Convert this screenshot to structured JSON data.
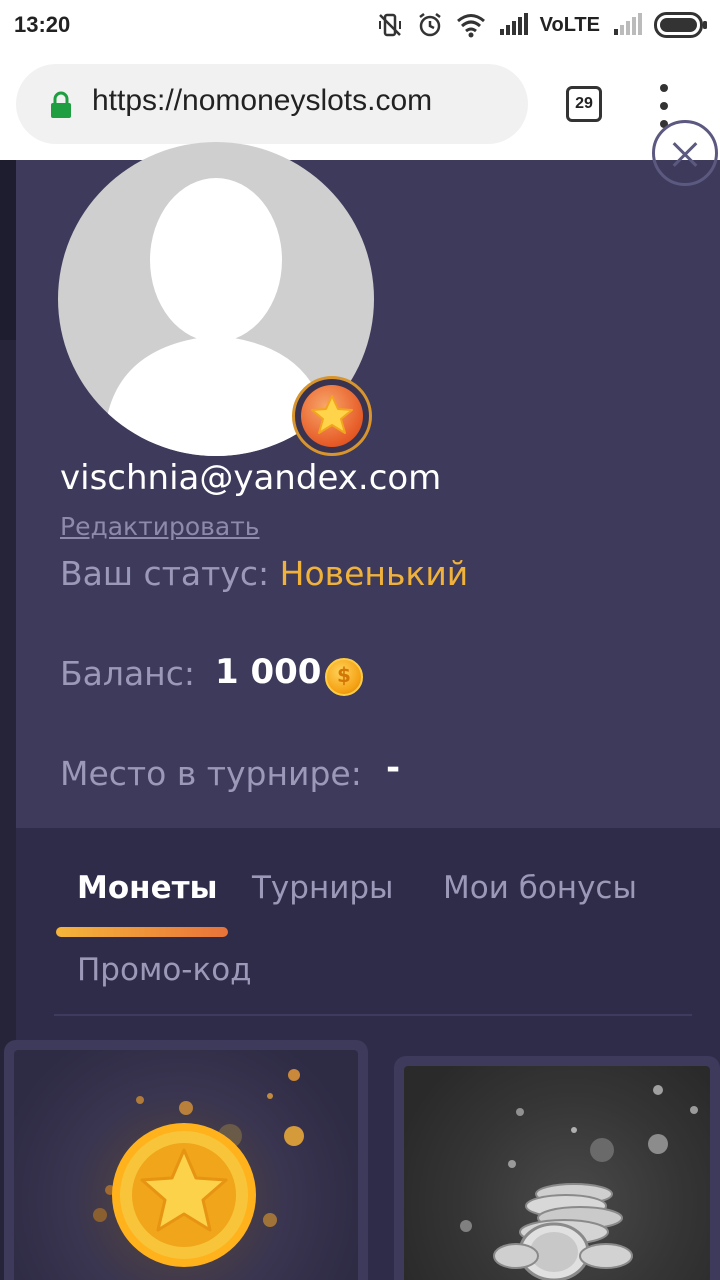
{
  "status_bar": {
    "time": "13:20",
    "network": "VoLTE",
    "icons": [
      "vibrate-off-icon",
      "alarm-icon",
      "wifi-icon",
      "signal-icon",
      "battery-icon"
    ]
  },
  "browser": {
    "url": "https://nomoneyslots.com",
    "tab_count": "29",
    "lock_color": "#1e9e40"
  },
  "profile": {
    "email": "vischnia@yandex.com",
    "edit_label": "Редактировать",
    "status_label": "Ваш статус: ",
    "status_value": "Новенький",
    "balance_label": "Баланс:",
    "balance_value": "1 000",
    "tournament_label": "Место в турнире:",
    "tournament_value": "-"
  },
  "tabs": {
    "items": [
      {
        "label": "Монеты",
        "active": true
      },
      {
        "label": "Турниры",
        "active": false
      },
      {
        "label": "Мои бонусы",
        "active": false
      },
      {
        "label": "Промо-код",
        "active": false
      }
    ]
  },
  "colors": {
    "panel": "#3d3a5c",
    "accent_orange": "#f0b23a",
    "text_muted": "#9c98b8"
  }
}
